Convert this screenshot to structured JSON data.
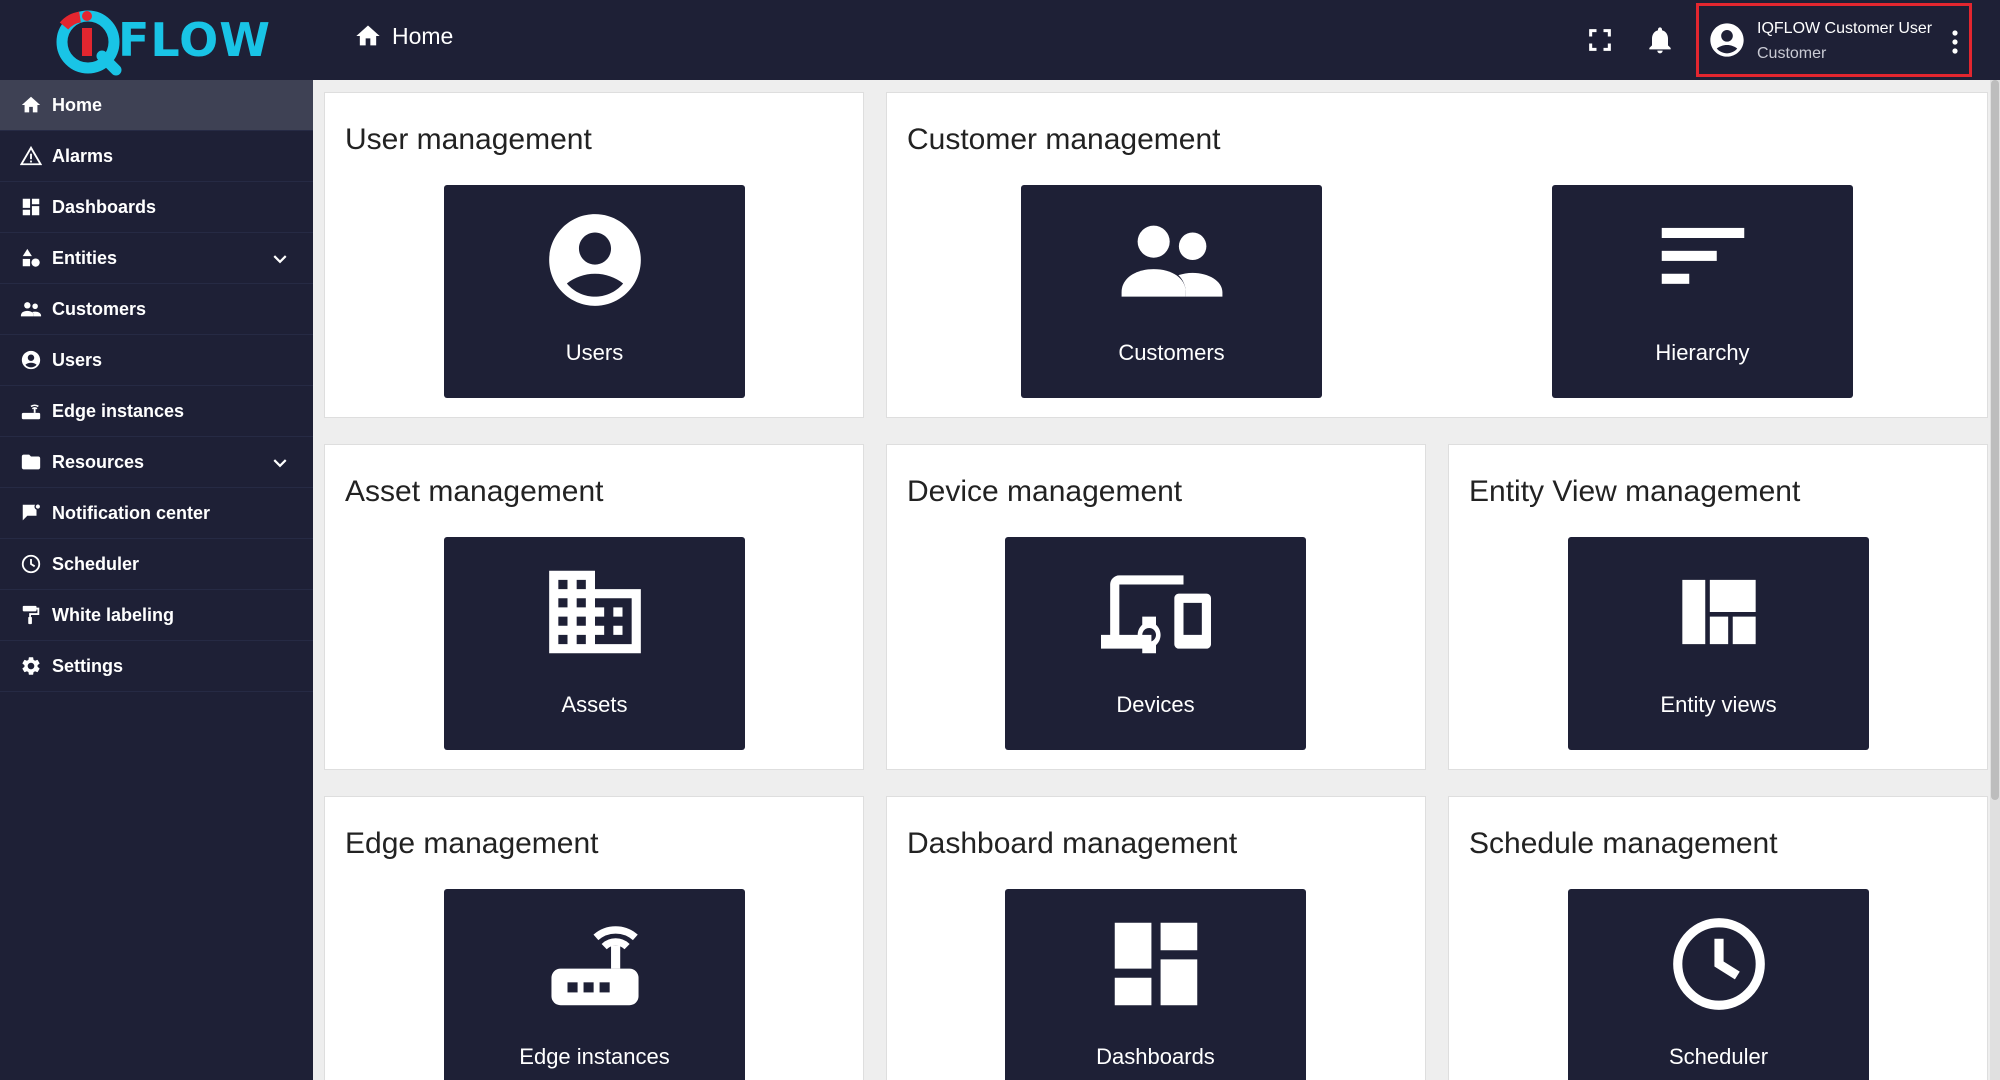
{
  "app": {
    "logo_text": "FLOW"
  },
  "header": {
    "breadcrumb": "Home",
    "user_name": "IQFLOW Customer User",
    "user_role": "Customer"
  },
  "sidebar": {
    "items": [
      {
        "label": "Home",
        "icon": "home-icon",
        "active": true
      },
      {
        "label": "Alarms",
        "icon": "warning-icon"
      },
      {
        "label": "Dashboards",
        "icon": "dashboard-icon"
      },
      {
        "label": "Entities",
        "icon": "shapes-icon",
        "expandable": true
      },
      {
        "label": "Customers",
        "icon": "people-icon"
      },
      {
        "label": "Users",
        "icon": "account-circle-icon"
      },
      {
        "label": "Edge instances",
        "icon": "router-icon"
      },
      {
        "label": "Resources",
        "icon": "folder-icon",
        "expandable": true
      },
      {
        "label": "Notification center",
        "icon": "notification-icon"
      },
      {
        "label": "Scheduler",
        "icon": "clock-icon"
      },
      {
        "label": "White labeling",
        "icon": "paint-roller-icon"
      },
      {
        "label": "Settings",
        "icon": "gear-icon"
      }
    ]
  },
  "cards": {
    "user": {
      "title": "User management",
      "tiles": [
        {
          "label": "Users",
          "icon": "account-circle-icon"
        }
      ]
    },
    "customer": {
      "title": "Customer management",
      "tiles": [
        {
          "label": "Customers",
          "icon": "people-icon"
        },
        {
          "label": "Hierarchy",
          "icon": "hierarchy-icon"
        }
      ]
    },
    "asset": {
      "title": "Asset management",
      "tiles": [
        {
          "label": "Assets",
          "icon": "building-icon"
        }
      ]
    },
    "device": {
      "title": "Device management",
      "tiles": [
        {
          "label": "Devices",
          "icon": "devices-icon"
        }
      ]
    },
    "entityview": {
      "title": "Entity View management",
      "tiles": [
        {
          "label": "Entity views",
          "icon": "view-quilt-icon"
        }
      ]
    },
    "edge": {
      "title": "Edge management",
      "tiles": [
        {
          "label": "Edge instances",
          "icon": "router-icon"
        }
      ]
    },
    "dashboard": {
      "title": "Dashboard management",
      "tiles": [
        {
          "label": "Dashboards",
          "icon": "dashboard-icon"
        }
      ]
    },
    "schedule": {
      "title": "Schedule management",
      "tiles": [
        {
          "label": "Scheduler",
          "icon": "clock-icon"
        }
      ]
    }
  },
  "colors": {
    "nav_bg": "#1e2036",
    "active_item": "#3e4154",
    "logo_cyan": "#19c4e6",
    "logo_red": "#e3262f",
    "highlight": "#e3262f"
  }
}
